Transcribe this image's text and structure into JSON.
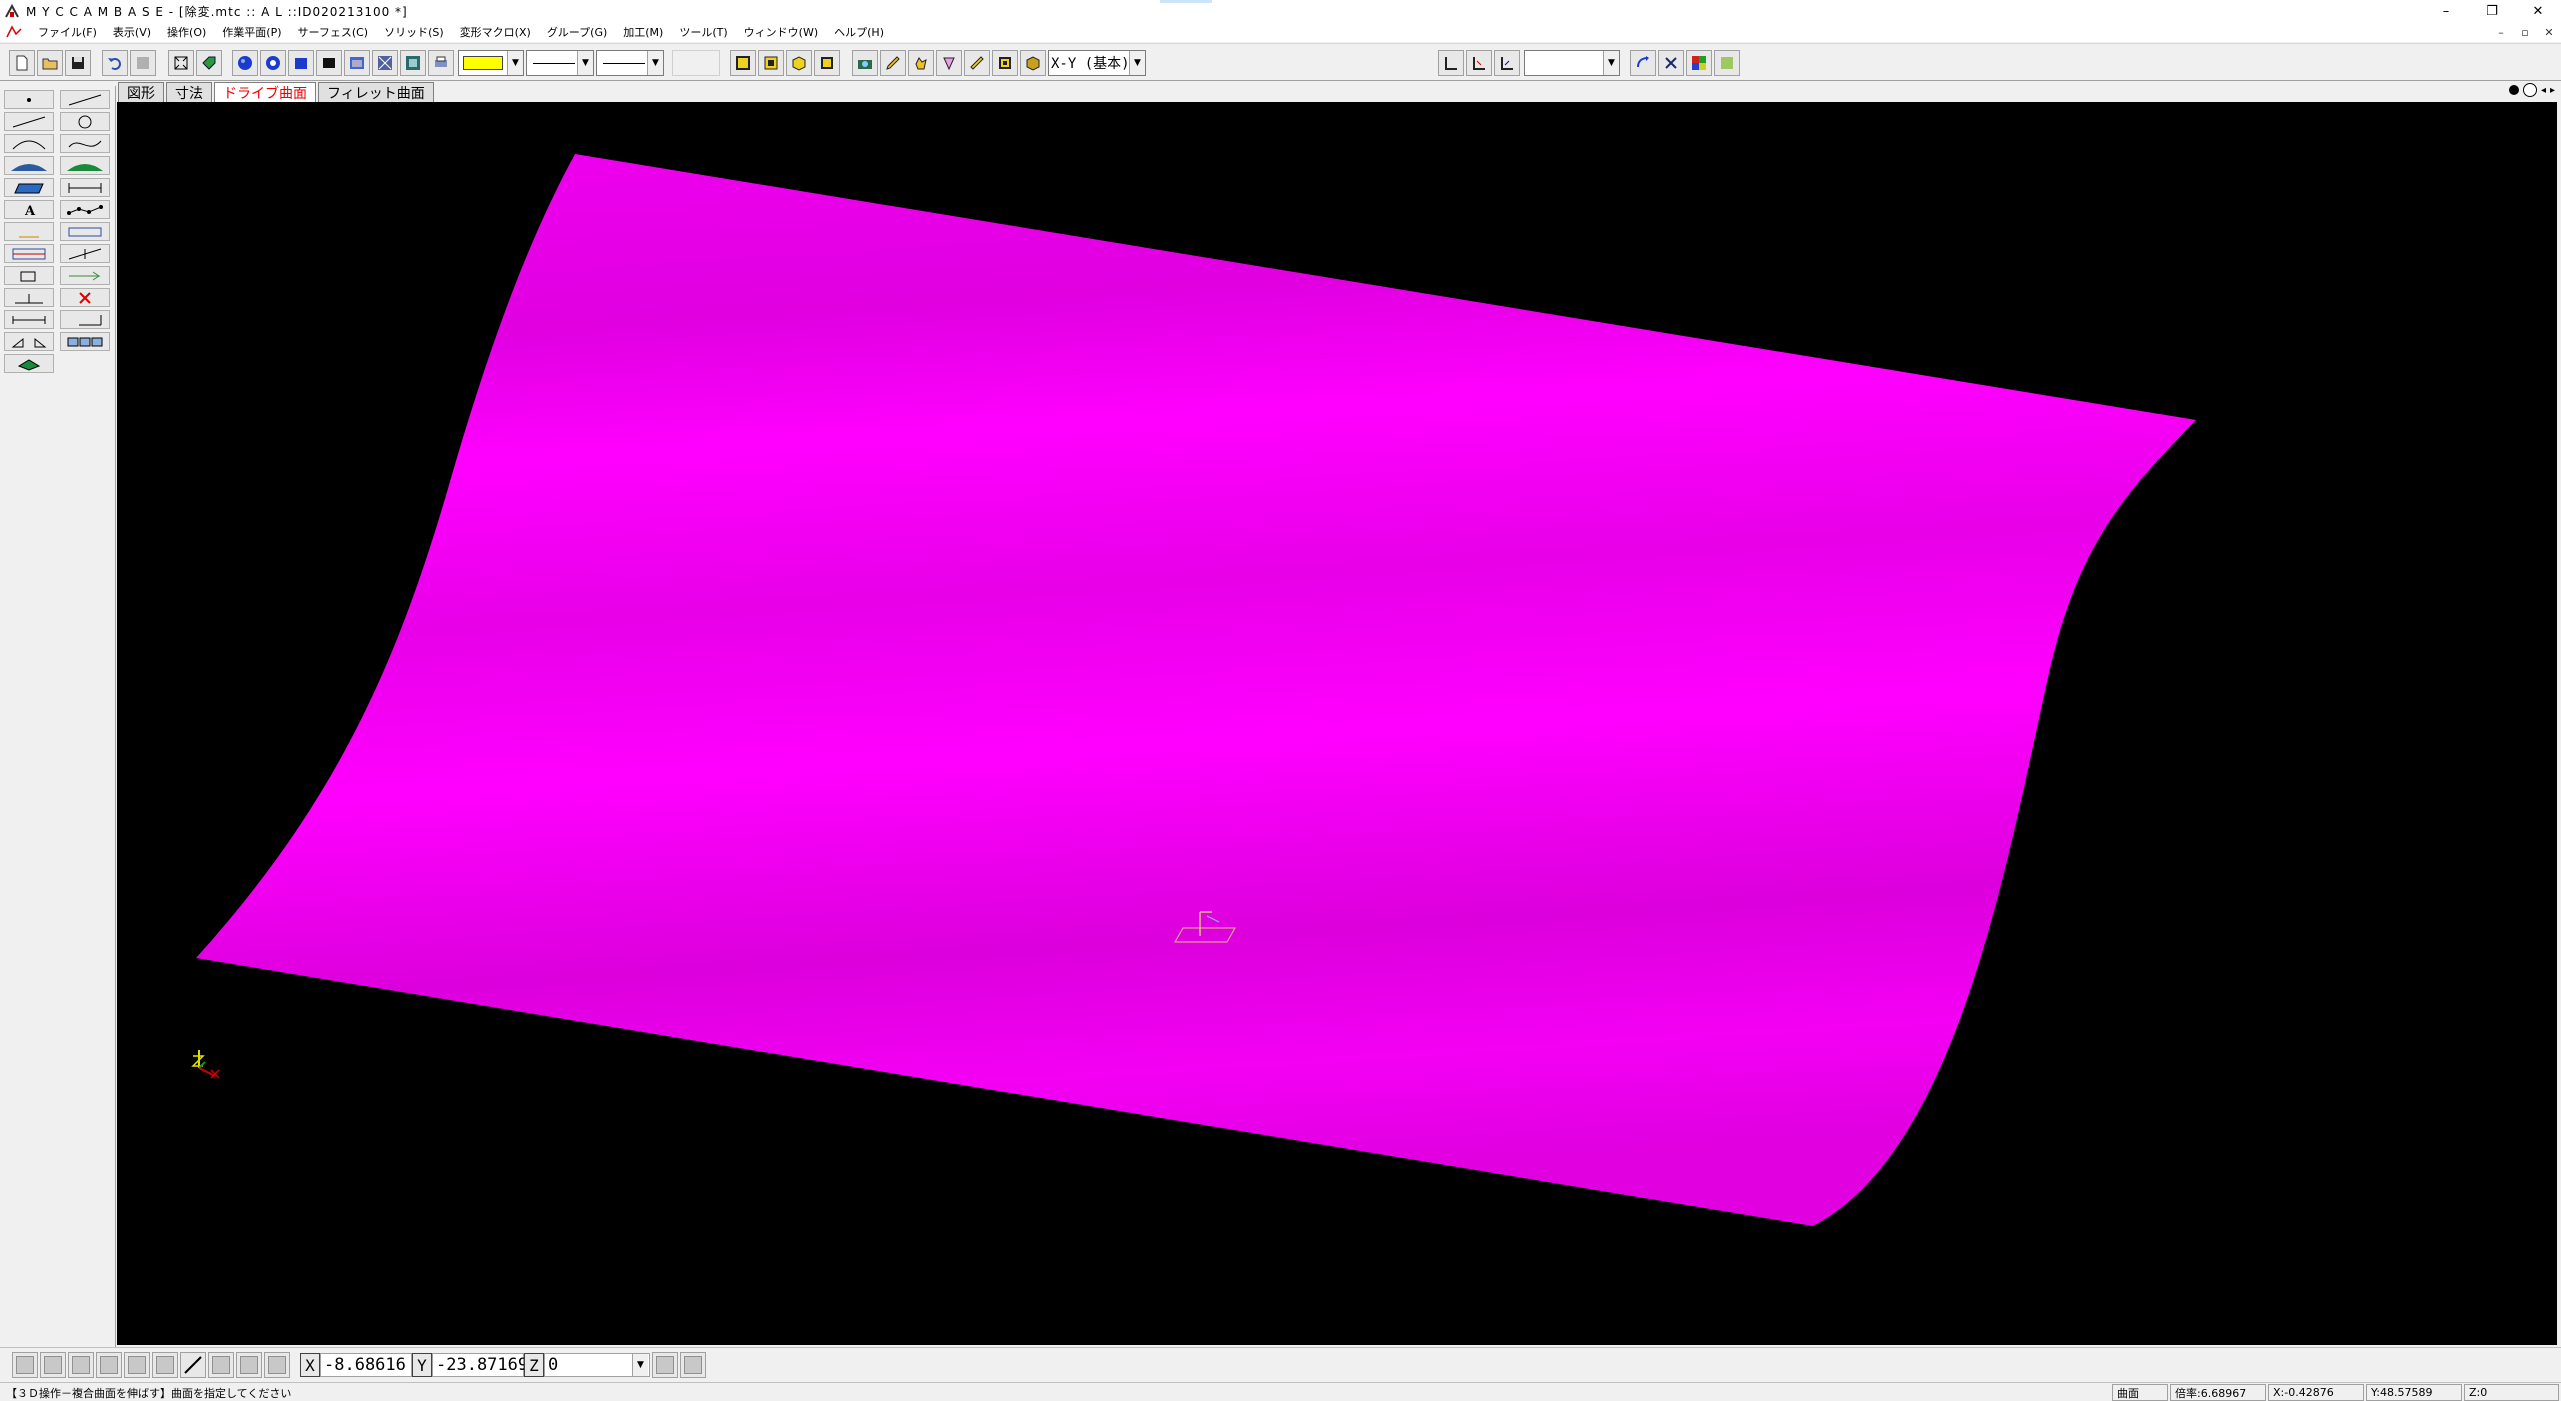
{
  "window": {
    "title": "M Y C  C A M B A S E - [除変.mtc :: A L ::ID020213100 *]",
    "controls": {
      "minimize": "–",
      "restore": "❐",
      "close": "✕"
    }
  },
  "menu": {
    "items": [
      "ファイル(F)",
      "表示(V)",
      "操作(O)",
      "作業平面(P)",
      "サーフェス(C)",
      "ソリッド(S)",
      "変形マクロ(X)",
      "グループ(G)",
      "加工(M)",
      "ツール(T)",
      "ウィンドウ(W)",
      "ヘルプ(H)"
    ],
    "mdi": {
      "minimize": "–",
      "restore": "▫",
      "close": "✕"
    }
  },
  "toolbar": {
    "color_swatch": "#ffff00",
    "view_plane": "X-Y (基本)",
    "right_combo": ""
  },
  "tabs": [
    "図形",
    "寸法",
    "ドライブ曲面",
    "フィレット曲面"
  ],
  "active_tab": 2,
  "coords": {
    "x_label": "X",
    "x_value": "-8.68616",
    "y_label": "Y",
    "y_value": "-23.87169",
    "z_label": "Z",
    "z_value": "0"
  },
  "status": {
    "message": "【３Ｄ操作－複合曲面を伸ばす】曲面を指定してください",
    "mode": "曲面",
    "zoom": "倍率:6.68967",
    "x": "X:-0.42876",
    "y": "Y:48.57589",
    "z": "Z:0"
  },
  "colors": {
    "surface": "#ff00ff",
    "surface_shade": "#d000d0",
    "canvas": "#000000"
  },
  "icons": {
    "palette": [
      "point-icon",
      "line-icon",
      "line2-icon",
      "circle-icon",
      "arc-icon",
      "spline-icon",
      "surface-icon",
      "surface2-icon",
      "solid-icon",
      "dimension-icon",
      "text-icon",
      "polyline-icon",
      "hatch-icon",
      "ruler-icon",
      "frame-icon",
      "slash-icon",
      "move-icon",
      "arrow-icon",
      "rotate-icon",
      "delete-icon",
      "distance-icon",
      "scale-icon",
      "mirror-icon",
      "array-icon",
      "layer-icon"
    ]
  }
}
